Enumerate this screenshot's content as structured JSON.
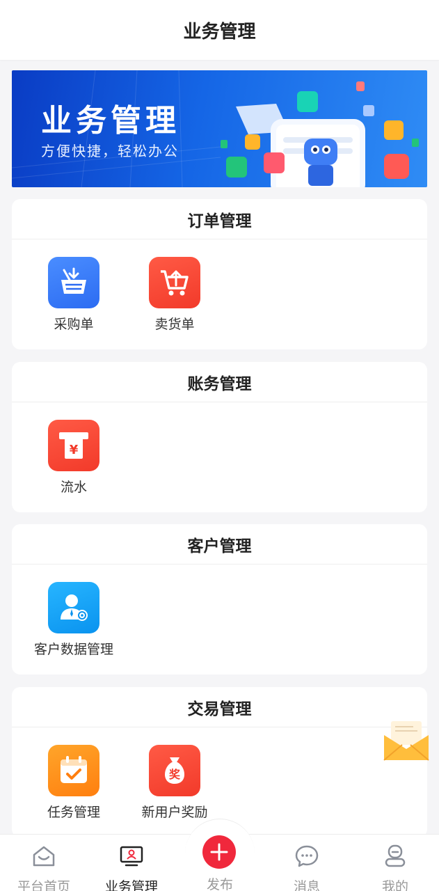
{
  "header": {
    "title": "业务管理"
  },
  "banner": {
    "title": "业务管理",
    "subtitle": "方便快捷，轻松办公"
  },
  "sections": [
    {
      "title": "订单管理",
      "items": [
        {
          "label": "采购单",
          "icon": "basket-icon"
        },
        {
          "label": "卖货单",
          "icon": "cart-icon"
        }
      ]
    },
    {
      "title": "账务管理",
      "items": [
        {
          "label": "流水",
          "icon": "yuan-receipt-icon"
        }
      ]
    },
    {
      "title": "客户管理",
      "items": [
        {
          "label": "客户数据管理",
          "icon": "customer-settings-icon"
        }
      ]
    },
    {
      "title": "交易管理",
      "items": [
        {
          "label": "任务管理",
          "icon": "calendar-check-icon"
        },
        {
          "label": "新用户奖励",
          "icon": "reward-bag-icon"
        }
      ]
    }
  ],
  "reward_badge_text": "奖",
  "yuan_symbol": "¥",
  "tabbar": {
    "tabs": [
      {
        "label": "平台首页",
        "icon": "home-icon"
      },
      {
        "label": "业务管理",
        "icon": "monitor-user-icon"
      },
      {
        "label": "发布",
        "icon": "plus-icon"
      },
      {
        "label": "消息",
        "icon": "chat-bubble-icon"
      },
      {
        "label": "我的",
        "icon": "profile-icon"
      }
    ],
    "active_tab": "业务管理"
  },
  "colors": {
    "accent_red": "#f0283c",
    "blue": "#2c6cf2",
    "orange": "#ff7f0f",
    "cyan": "#0a93ef"
  }
}
